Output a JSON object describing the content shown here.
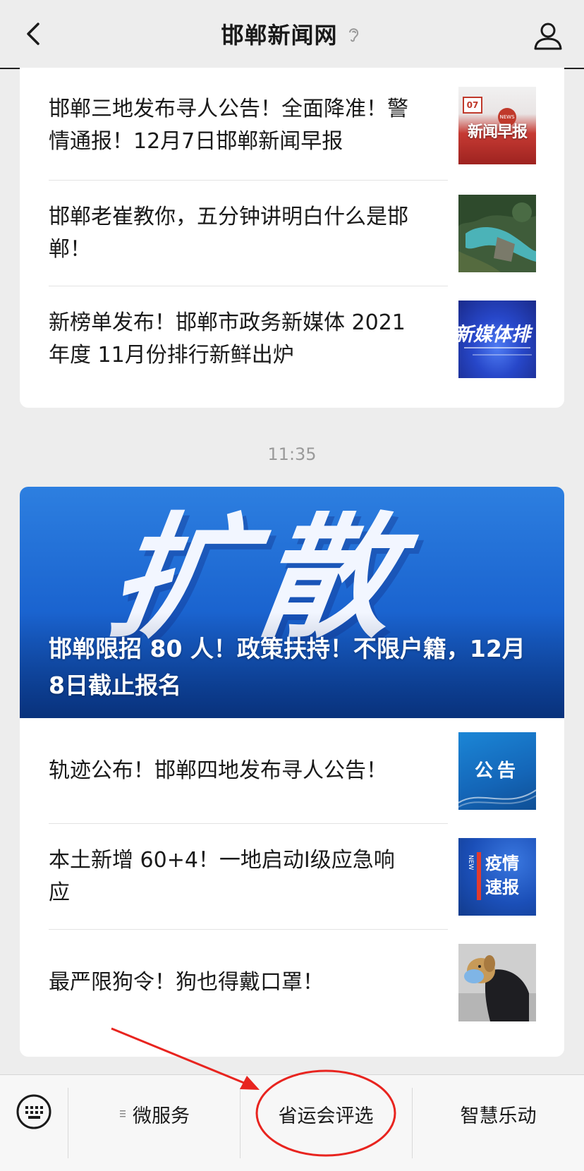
{
  "header": {
    "title": "邯郸新闻网",
    "back_icon": "chevron-left-icon",
    "ear_icon": "ear-icon",
    "profile_icon": "user-icon"
  },
  "feed": {
    "card1_articles": [
      {
        "title": "邯郸三地发布寻人公告！全面降准！警情通报！12月7日邯郸新闻早报",
        "thumb_text_1": "07",
        "thumb_text_2": "新闻早报",
        "thumb_text_3": "NEWS"
      },
      {
        "title": "邯郸老崔教你，五分钟讲明白什么是邯郸！"
      },
      {
        "title": "新榜单发布！邯郸市政务新媒体 2021 年度 11月份排行新鲜出炉",
        "thumb_text_1": "新媒体排"
      }
    ],
    "time": "11:35",
    "banner": {
      "big_text": "扩散",
      "caption": "邯郸限招 80 人！政策扶持！不限户籍，12月8日截止报名"
    },
    "card2_articles": [
      {
        "title": "轨迹公布！邯郸四地发布寻人公告！",
        "thumb_text_1": "公告"
      },
      {
        "title": "本土新增 60+4！一地启动Ⅰ级应急响应",
        "thumb_text_1": "疫情",
        "thumb_text_2": "速报",
        "thumb_text_3": "NEW"
      },
      {
        "title": "最严限狗令！狗也得戴口罩！"
      }
    ]
  },
  "menu": {
    "keyboard_icon": "keyboard-icon",
    "item1": "微服务",
    "item2": "省运会评选",
    "item3": "智慧乐动"
  },
  "colors": {
    "annotation": "#e8241f",
    "banner_blue": "#1a63cf"
  }
}
